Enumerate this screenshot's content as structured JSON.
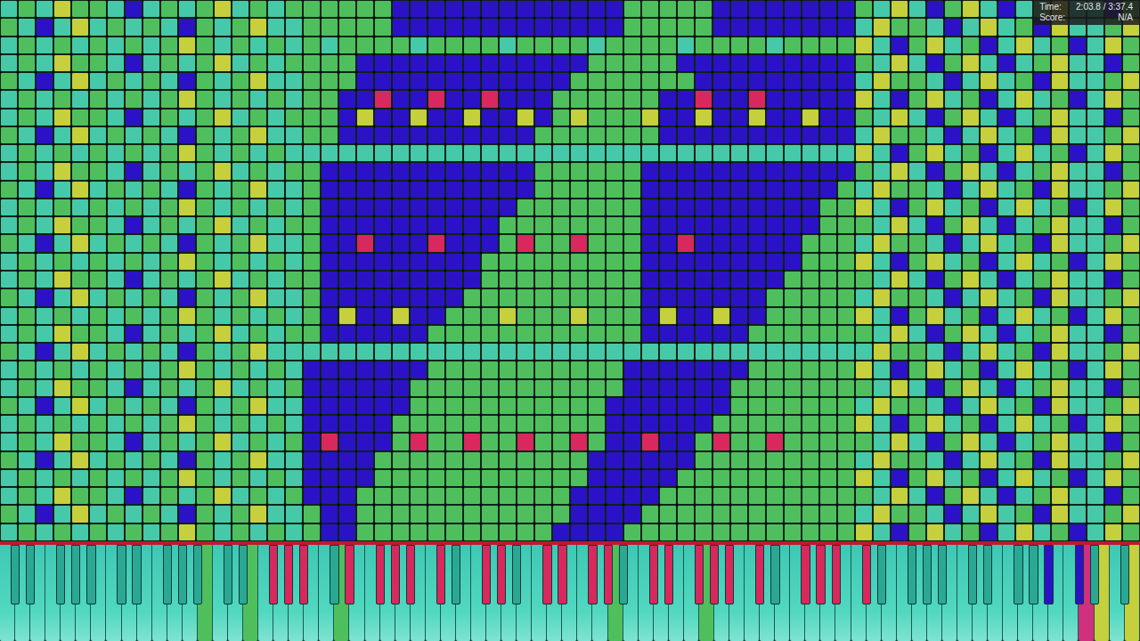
{
  "hud": {
    "rows": [
      {
        "label": "Time:",
        "value": "2:03.8 / 3:37.4"
      },
      {
        "label": "Score:",
        "value": "N/A"
      }
    ]
  },
  "tracks": [
    {
      "key": "g",
      "color": "#4fbf5e"
    },
    {
      "key": "t",
      "color": "#46c9a8"
    },
    {
      "key": "b",
      "color": "#2c12c6"
    },
    {
      "key": "y",
      "color": "#c6cf3c"
    },
    {
      "key": "r",
      "color": "#d8285e"
    },
    {
      "key": "p",
      "color": "#d0307e"
    }
  ],
  "note_roll": {
    "columns": 64,
    "rows": [
      "tgtyggtbtgtgytgtggggggbbbbbbbbbbbbbgggggbbbbbbbbgtytbgytbtgyttbg",
      "gtbtytgtgtbgtgyttgggggbbbbbbbbbbbbbgggggbbbbbbbbtyggtbtytgbyttgy",
      "tgtgtgtgtgygtgtgtgtggggtggggtggggtggggtggggtggggytbgytgbtytgbtyg",
      "tgtyggtbtgtgytgtggggbbbbbbbbbbbbbgggggbbbbbbbbbbgtytbgytbtgyttbg",
      "gtbtytgtgtbgtgyttgggbbbbbbbbbbbbgggggggbbbbbbbbbtyggtbtytgbyttgy",
      "tgtgtgtgtgygtgtgtggbbrbbrbbrbbbggggggbbrbbrbbbbbytbgytgbtytgbtyg",
      "tgtyggtbtgtgytgtgggbybbybbybbybgygggybbybbybbybbgtytbgytbtgyttbg",
      "gtbtytgtgtbgtgyttggbbbbbbbbbbbgggggggbbbbbbbbbbbtyggtbtytgbyttgy",
      "tgtgtgtgtgygtgtgttttttttttttttttttttttttttttttttytbgytgbtytgbtyg",
      "tgtyggtbtgtgytgtggbbbbbbbbbbbbggggggbbbbbbbbbbbbgtytbgytbtgyttbg",
      "gtbtytgtgtbgtgyttgbbbbbbbbbbbbggggggbbbbbbbbbbbgtyggtbtytgbyttgy",
      "tgtgtgtgtgygtgtgtgbbbbbbbbbbbgggggggbbbbbbbbbbggytbgytgbtytgbtyg",
      "tgtyggtbtgtgytgtggbbbbbbbbbbggggggggbbbbbbbbbbgggtytbgytbtgyttbg",
      "gtbtytgtgtbgtgyttgbbrbbbrbbbgrggrgggbbrbbbbbbgggtyggtbtytgbyttgy",
      "tgtgtgtgtgygtgtgtgbbbbbbbbbgggggggggbbbbbbbbbgggytbgytgbtytgbtyg",
      "tgtyggtbtgtgytgtggbbbbbbbbbgggggggggbbbbbbbbgggggtytbgytbtgyttbg",
      "gtbtytgtgtbgtgyttgbbbbbbbbggggggggggbbbbbbbgggggtyggtbtytgbyttgy",
      "tgtgtgtgtgygtgtgtgbybbybbgggygggygggbybbybbgggggytbgytgbtytgbtyg",
      "tgtyggtbtgtgytgtggbbbbbbggggggggggggbbbbbbgggggggtytbgytbtgyttbg",
      "gtbtytgtgtbgtgyttttttttttttttttttttttttttttttttttyggtbtytgbyttgy",
      "tgtgtgtgtgygtgtgtbbbbbbbgggggggggggbbbbbbbggggggytbgytgbtytgbtyg",
      "tgtyggtbtgtgytgtgbbbbbbggggggggggggbbbbbbggggggggtytbgytbtgyttbg",
      "gtbtytgtgtbgtgyttbbbbbbgggggggggggbbbbbbbgggggggtyggtbtytgbyttgy",
      "tgtgtgtgtgygtgtgtbbbbbggggggggggggbbbbbbggggggggytbgytgbtytgbtyg",
      "tgtyggtbtgtgytgtgbrbbbgrggrggrggrgbbrbbgrggrgggggtytbgytbtgyttbg",
      "gtbtytgtgtbgtgyttbbbbggggggggggggbbbbbbgggggggggtyggtbtytgbyttgy",
      "tgtgtgtgtgygtgtgtbbbbggggggggggggbbbbbggggggggggytbgytgbtytgbtyg",
      "tgtyggtbtgtgytgtgbbbggggggggggggbbbbbggggggggggggtytbgytbtgyttbg",
      "gtbtytgtgtbgtgyttgbbggggggggggggbbbbggggggggggggtyggtbtytgbyttgy",
      "tgtgtgtgtgygtgtgtgbbgggggggggggbbbbgggggggggggggytbgytgbtytgbtyg"
    ]
  },
  "keyboard": {
    "white": ".............g..g.....g.................g.....g........................py.y",
    "black": "............rrr.rrrrr.rr.rrrr.rrrrrr.rrrr........bb.."
  }
}
